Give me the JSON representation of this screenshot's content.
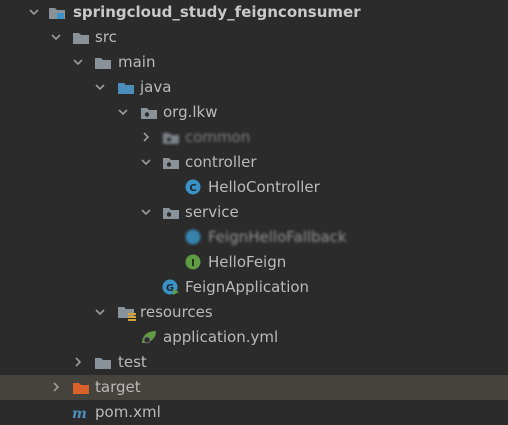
{
  "tree": {
    "root": "springcloud_study_feignconsumer",
    "src": "src",
    "main": "main",
    "java": "java",
    "package": "org.lkw",
    "hidden_package": "common",
    "controller": "controller",
    "hello_controller": "HelloController",
    "service": "service",
    "hidden_class": "FeignHelloFallback",
    "hello_feign": "HelloFeign",
    "feign_application": "FeignApplication",
    "resources": "resources",
    "application_yml": "application.yml",
    "test": "test",
    "target": "target",
    "pom": "pom.xml"
  },
  "colors": {
    "background": "#2b2b2b",
    "selected_row": "#45433c",
    "folder": "#8a9299",
    "source_folder": "#4b8eb9",
    "excluded_folder": "#d9622b",
    "class_icon": "#3a93c6",
    "interface_icon": "#5f9c43"
  },
  "icons": {
    "folder": "folder-icon",
    "package": "package-icon",
    "class": "class-icon",
    "interface": "interface-icon",
    "spring_boot": "spring-boot-app-icon",
    "resources": "resources-folder-icon",
    "yaml": "yaml-file-icon",
    "maven": "maven-pom-icon"
  }
}
